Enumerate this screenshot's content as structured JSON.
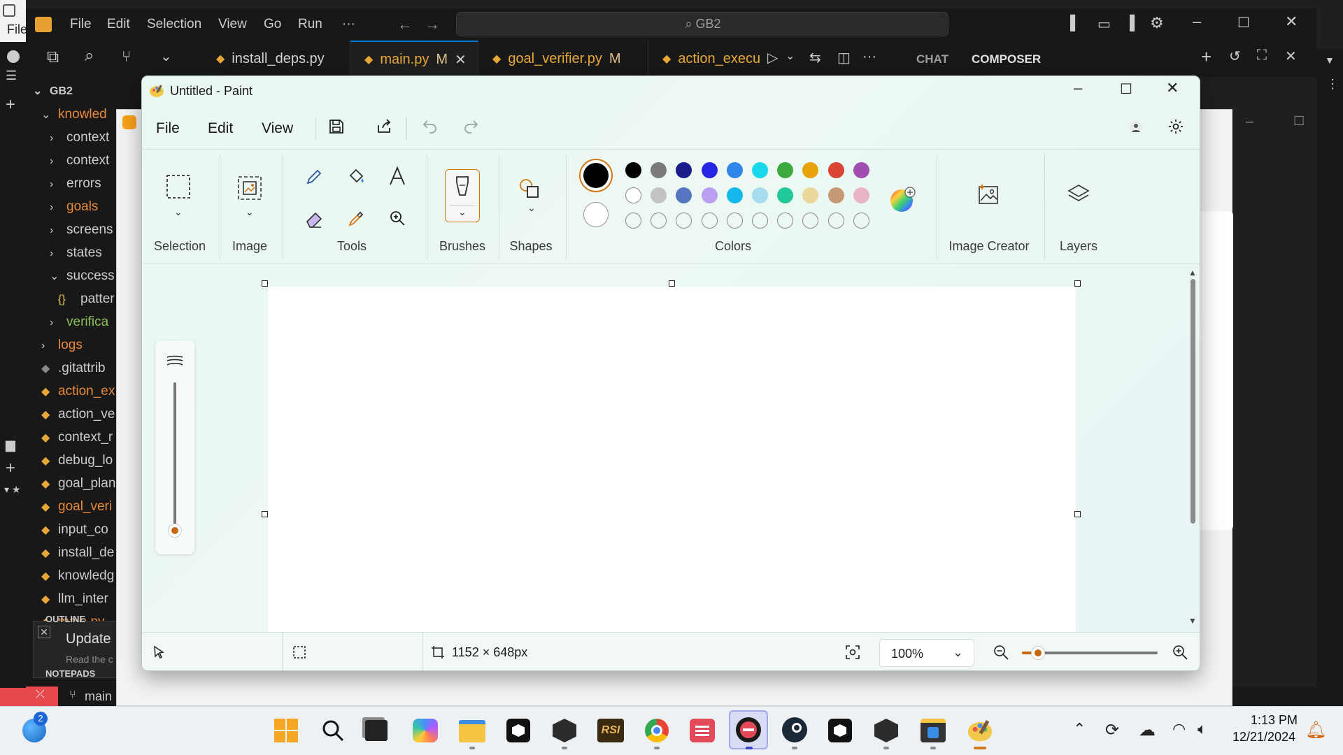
{
  "vscode": {
    "menu": [
      "File",
      "Edit",
      "Selection",
      "View",
      "Go",
      "Run",
      "···"
    ],
    "command_center": "GB2",
    "left_partial_text": "File",
    "tabs": [
      {
        "name": "install_deps.py",
        "mod": ""
      },
      {
        "name": "main.py",
        "mod": "M"
      },
      {
        "name": "goal_verifier.py",
        "mod": "M"
      },
      {
        "name": "action_execu",
        "mod": ""
      }
    ],
    "chat_tab": "CHAT",
    "composer_tab": "COMPOSER",
    "explorer_root": "GB2",
    "tree": [
      {
        "label": "knowled",
        "color": "#e8893a",
        "indent": 1,
        "kind": "open"
      },
      {
        "label": "context",
        "color": "#cccccc",
        "indent": 2,
        "kind": "folder"
      },
      {
        "label": "context",
        "color": "#cccccc",
        "indent": 2,
        "kind": "folder"
      },
      {
        "label": "errors",
        "color": "#cccccc",
        "indent": 2,
        "kind": "folder"
      },
      {
        "label": "goals",
        "color": "#e8893a",
        "indent": 2,
        "kind": "folder"
      },
      {
        "label": "screens",
        "color": "#cccccc",
        "indent": 2,
        "kind": "folder"
      },
      {
        "label": "states",
        "color": "#cccccc",
        "indent": 2,
        "kind": "folder"
      },
      {
        "label": "success",
        "color": "#cccccc",
        "indent": 2,
        "kind": "open"
      },
      {
        "label": "patter",
        "color": "#cccccc",
        "indent": 3,
        "kind": "json"
      },
      {
        "label": "verifica",
        "color": "#8fbf5a",
        "indent": 2,
        "kind": "folder"
      },
      {
        "label": "logs",
        "color": "#e8893a",
        "indent": 1,
        "kind": "folder"
      },
      {
        "label": ".gitattrib",
        "color": "#cccccc",
        "indent": 1,
        "kind": "git"
      },
      {
        "label": "action_ex",
        "color": "#e8893a",
        "indent": 1,
        "kind": "py"
      },
      {
        "label": "action_ve",
        "color": "#cccccc",
        "indent": 1,
        "kind": "py"
      },
      {
        "label": "context_r",
        "color": "#cccccc",
        "indent": 1,
        "kind": "py"
      },
      {
        "label": "debug_lo",
        "color": "#cccccc",
        "indent": 1,
        "kind": "py"
      },
      {
        "label": "goal_plan",
        "color": "#cccccc",
        "indent": 1,
        "kind": "py"
      },
      {
        "label": "goal_veri",
        "color": "#e8893a",
        "indent": 1,
        "kind": "py"
      },
      {
        "label": "input_co",
        "color": "#cccccc",
        "indent": 1,
        "kind": "py"
      },
      {
        "label": "install_de",
        "color": "#cccccc",
        "indent": 1,
        "kind": "py"
      },
      {
        "label": "knowledg",
        "color": "#cccccc",
        "indent": 1,
        "kind": "py"
      },
      {
        "label": "llm_inter",
        "color": "#cccccc",
        "indent": 1,
        "kind": "py"
      },
      {
        "label": "main.py",
        "color": "#e8893a",
        "indent": 1,
        "kind": "py"
      }
    ],
    "outline_label": "OUTLINE",
    "toast_title": "Update",
    "toast_body": "Read the c",
    "timeline_label": "NOTEPADS",
    "status_branch": "main"
  },
  "paint": {
    "title": "Untitled - Paint",
    "menu": [
      "File",
      "Edit",
      "View"
    ],
    "groups": {
      "selection": "Selection",
      "image": "Image",
      "tools": "Tools",
      "brushes": "Brushes",
      "shapes": "Shapes",
      "colors": "Colors",
      "image_creator": "Image Creator",
      "layers": "Layers"
    },
    "palette_row1": [
      "#000000",
      "#7a7a7a",
      "#1c1c8a",
      "#2727e3",
      "#2f86e8",
      "#1ad8ec",
      "#3daa3d",
      "#e8a30c",
      "#d94434",
      "#a14eb3"
    ],
    "palette_row2": [
      "#ffffff",
      "#c3c3c3",
      "#5577c0",
      "#b9a0f0",
      "#14b8ea",
      "#a6dcef",
      "#22c79a",
      "#ead79c",
      "#c49a76",
      "#e8b5c6"
    ],
    "primary_color": "#000000",
    "secondary_color": "#ffffff",
    "canvas_size": "1152 × 648px",
    "zoom": "100%",
    "zoom_slider_value": 0.12
  },
  "taskbar": {
    "time": "1:13 PM",
    "date": "12/21/2024",
    "notification_count": "2",
    "rsi_label": "RSI"
  }
}
